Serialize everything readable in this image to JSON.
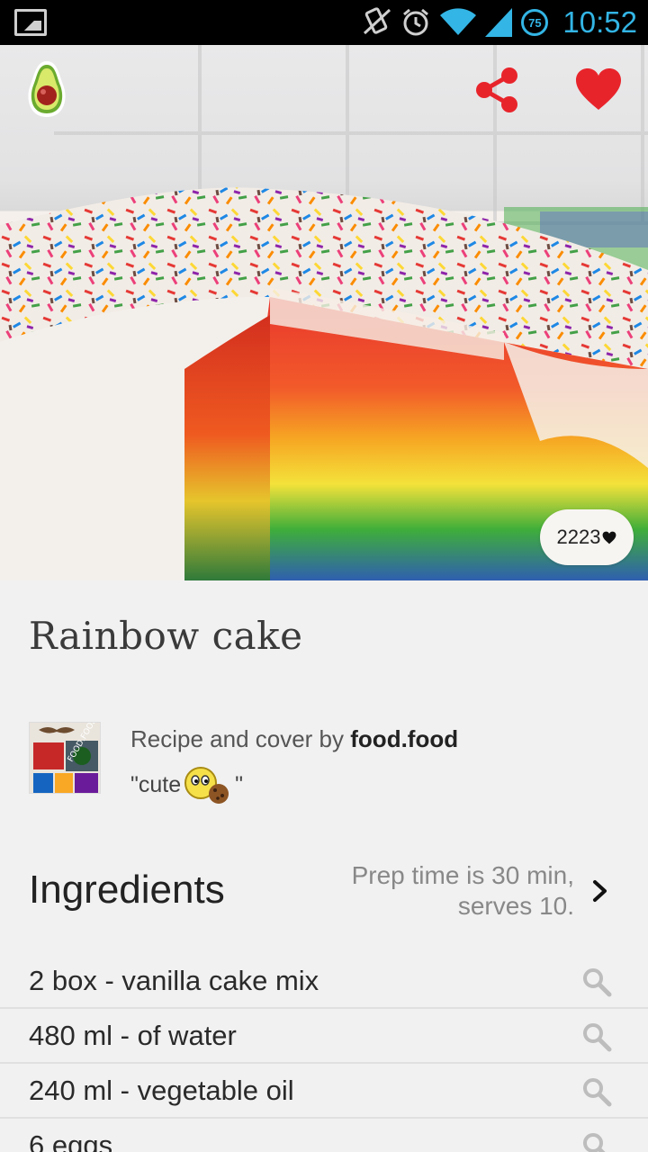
{
  "status_bar": {
    "battery_badge": "75",
    "time": "10:52"
  },
  "recipe": {
    "title": "Rainbow cake",
    "likes": "2223",
    "author_prefix": "Recipe and cover by",
    "author_name": "food.food",
    "author_note": "\"cute",
    "author_note_end": "\""
  },
  "ingredients_section": {
    "heading": "Ingredients",
    "prep_line1": "Prep time is 30 min,",
    "prep_line2": "serves 10."
  },
  "ingredients": [
    "2 box - vanilla cake mix",
    "480 ml - of water",
    "240 ml - vegetable oil",
    "6 eggs"
  ],
  "colors": {
    "accent_red": "#e8242b",
    "status_blue": "#33b5e5",
    "background": "#f1f1f1"
  },
  "icons": {
    "app_logo": "avocado-icon",
    "share": "share-icon",
    "favorite": "heart-icon",
    "search": "search-icon",
    "chevron": "chevron-right-icon"
  }
}
